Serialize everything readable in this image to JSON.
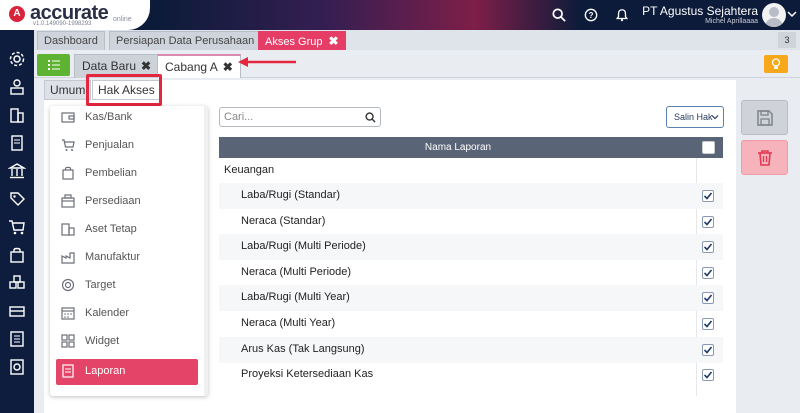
{
  "header": {
    "logo_text": "accurate",
    "logo_online": "online",
    "version": "v1.0.149090-1998293",
    "company": "PT Agustus Sejahtera",
    "user": "Michel Aprillaaaa"
  },
  "tabs": [
    {
      "label": "Dashboard"
    },
    {
      "label": "Persiapan Data Perusahaan"
    },
    {
      "label": "Akses Grup",
      "close": "✖"
    }
  ],
  "tab_count": "3",
  "subtabs": [
    {
      "label": "Data Baru",
      "close": "✖"
    },
    {
      "label": "Cabang A",
      "close": "✖"
    }
  ],
  "inner_tabs": [
    "Umum",
    "Hak Akses"
  ],
  "menu": [
    {
      "label": "Kas/Bank",
      "icon": "wallet-icon"
    },
    {
      "label": "Penjualan",
      "icon": "cart-icon"
    },
    {
      "label": "Pembelian",
      "icon": "bag-icon"
    },
    {
      "label": "Persediaan",
      "icon": "box-icon"
    },
    {
      "label": "Aset Tetap",
      "icon": "building-icon"
    },
    {
      "label": "Manufaktur",
      "icon": "factory-icon"
    },
    {
      "label": "Target",
      "icon": "target-icon"
    },
    {
      "label": "Kalender",
      "icon": "calendar-icon"
    },
    {
      "label": "Widget",
      "icon": "widget-icon"
    },
    {
      "label": "Laporan",
      "icon": "report-icon",
      "active": true
    }
  ],
  "search": {
    "placeholder": "Cari..."
  },
  "copy_button": "Salin Hak",
  "table": {
    "header": "Nama Laporan",
    "group": "Keuangan",
    "rows": [
      {
        "label": "Laba/Rugi (Standar)",
        "checked": true
      },
      {
        "label": "Neraca (Standar)",
        "checked": true
      },
      {
        "label": "Laba/Rugi (Multi Periode)",
        "checked": true
      },
      {
        "label": "Neraca (Multi Periode)",
        "checked": true
      },
      {
        "label": "Laba/Rugi (Multi Year)",
        "checked": true
      },
      {
        "label": "Neraca (Multi Year)",
        "checked": true
      },
      {
        "label": "Arus Kas (Tak Langsung)",
        "checked": true
      },
      {
        "label": "Proyeksi Ketersediaan Kas",
        "checked": true
      }
    ]
  },
  "colors": {
    "accent": "#e53d66",
    "header": "#0d1b3a",
    "annotation": "#e4273e",
    "green": "#5eb432",
    "orange": "#f4a81a"
  }
}
